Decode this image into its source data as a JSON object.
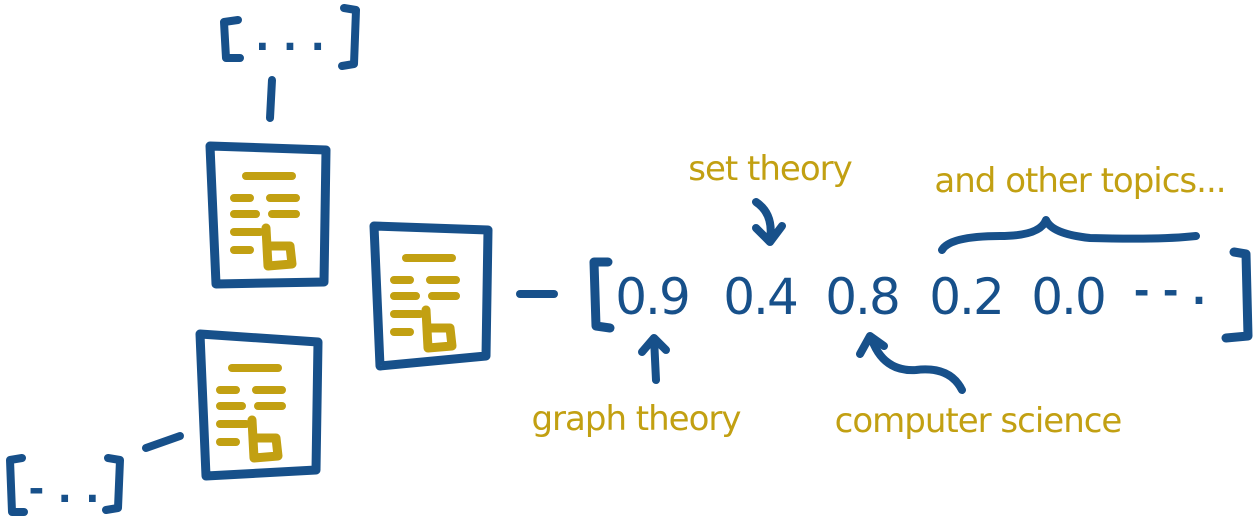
{
  "vector": {
    "values": [
      "0.9",
      "0.4",
      "0.8",
      "0.2",
      "0.0"
    ],
    "ellipsis": "- - ."
  },
  "placeholders": {
    "top": ". . .",
    "bottom": "- . ."
  },
  "labels": {
    "set_theory": "set theory",
    "other_topics": "and other topics...",
    "graph_theory": "graph theory",
    "computer_science": "computer science"
  },
  "colors": {
    "ink": "#17508a",
    "label": "#c2a012",
    "document_icon": "#c2a012",
    "background": "#ffffff"
  },
  "icons": [
    "document-icon",
    "arrow-down-icon",
    "arrow-up-icon",
    "brace-icon"
  ]
}
